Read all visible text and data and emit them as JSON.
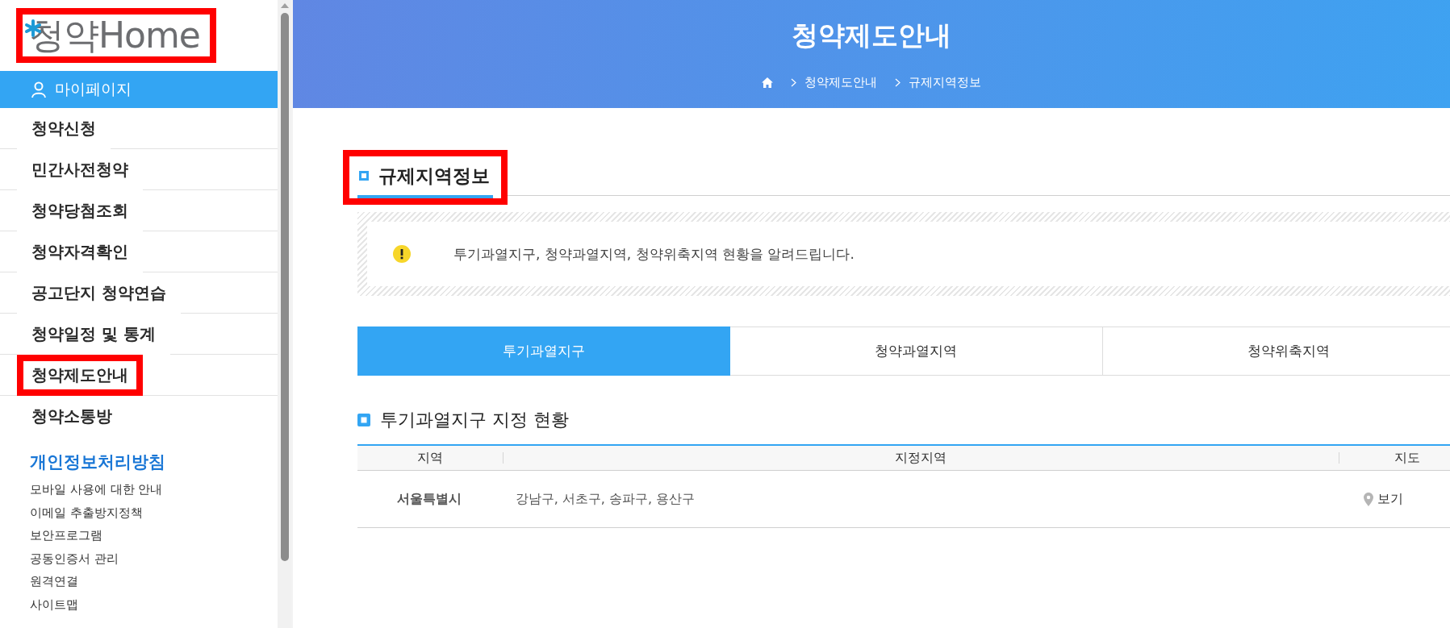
{
  "logo": {
    "text": "청약Home",
    "highlighted": true
  },
  "sidebar": {
    "mypage": "마이페이지",
    "items": [
      {
        "label": "청약신청",
        "highlighted": false
      },
      {
        "label": "민간사전청약",
        "highlighted": false
      },
      {
        "label": "청약당첨조회",
        "highlighted": false
      },
      {
        "label": "청약자격확인",
        "highlighted": false
      },
      {
        "label": "공고단지 청약연습",
        "highlighted": false
      },
      {
        "label": "청약일정 및 통계",
        "highlighted": false
      },
      {
        "label": "청약제도안내",
        "highlighted": true
      },
      {
        "label": "청약소통방",
        "highlighted": false
      }
    ],
    "privacy_link": "개인정보처리방침",
    "links": [
      "모바일 사용에 대한 안내",
      "이메일 추출방지정책",
      "보안프로그램",
      "공동인증서 관리",
      "원격연결",
      "사이트맵"
    ]
  },
  "header": {
    "title": "청약제도안내",
    "breadcrumb": [
      "청약제도안내",
      "규제지역정보"
    ]
  },
  "section": {
    "title": "규제지역정보",
    "highlighted": true,
    "notice": "투기과열지구, 청약과열지역, 청약위축지역 현황을 알려드립니다.",
    "tabs": [
      {
        "label": "투기과열지구",
        "selected": true
      },
      {
        "label": "청약과열지역",
        "selected": false
      },
      {
        "label": "청약위축지역",
        "selected": false
      }
    ],
    "subtitle": "투기과열지구 지정 현황",
    "table": {
      "columns": [
        "지역",
        "지정지역",
        "지도"
      ],
      "rows": [
        {
          "region": "서울특별시",
          "areas": "강남구, 서초구, 송파구, 용산구",
          "map": "보기"
        }
      ]
    }
  }
}
